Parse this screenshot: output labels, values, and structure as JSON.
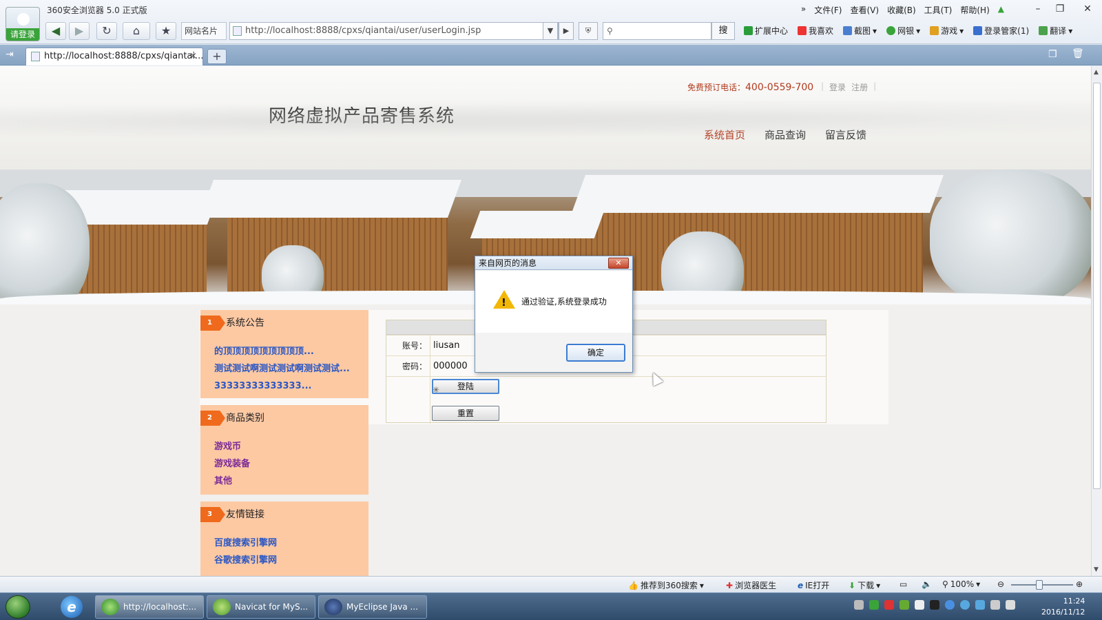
{
  "browser": {
    "title": "360安全浏览器 5.0 正式版",
    "login_label": "请登录",
    "menu": [
      "文件(F)",
      "查看(V)",
      "收藏(B)",
      "工具(T)",
      "帮助(H)"
    ],
    "site_card": "网站名片",
    "url": "http://localhost:8888/cpxs/qiantai/user/userLogin.jsp",
    "search_button": "搜",
    "extensions": [
      "扩展中心",
      "我喜欢",
      "截图",
      "网银",
      "游戏",
      "登录管家(1)",
      "翻译"
    ],
    "tab_title": "http://localhost:8888/cpxs/qiantai...",
    "tab_close": "×",
    "new_tab": "+"
  },
  "page": {
    "hotline_label": "免费预订电话：",
    "hotline_number": "400-0559-700",
    "login_link": "登录",
    "register_link": "注册",
    "site_title": "网络虚拟产品寄售系统",
    "nav": [
      "系统首页",
      "商品查询",
      "留言反馈"
    ],
    "panels": [
      {
        "num": "1",
        "title": "系统公告",
        "items": [
          "的顶顶顶顶顶顶顶顶顶...",
          "测试测试啊测试测试啊测试测试...",
          "33333333333333..."
        ]
      },
      {
        "num": "2",
        "title": "商品类别",
        "items": [
          "游戏币",
          "游戏装备",
          "其他"
        ]
      },
      {
        "num": "3",
        "title": "友情链接",
        "items": [
          "百度搜索引擎网",
          "谷歌搜索引擎网"
        ]
      }
    ],
    "form": {
      "account_label": "账号：",
      "account_value": "liusan",
      "password_label": "密码：",
      "password_value": "000000",
      "login_button": "登陆",
      "reset_button": "重置"
    }
  },
  "dialog": {
    "title": "来自网页的消息",
    "message": "通过验证,系统登录成功",
    "ok_button": "确定",
    "close": "✕"
  },
  "status_bar": {
    "recommend": "推荐到360搜索",
    "doctor": "浏览器医生",
    "ie_open": "IE打开",
    "download": "下载",
    "zoom": "100%"
  },
  "taskbar": {
    "tasks": [
      "http://localhost:...",
      "Navicat for MyS...",
      "MyEclipse Java ..."
    ],
    "time": "11:24",
    "date": "2016/11/12"
  }
}
